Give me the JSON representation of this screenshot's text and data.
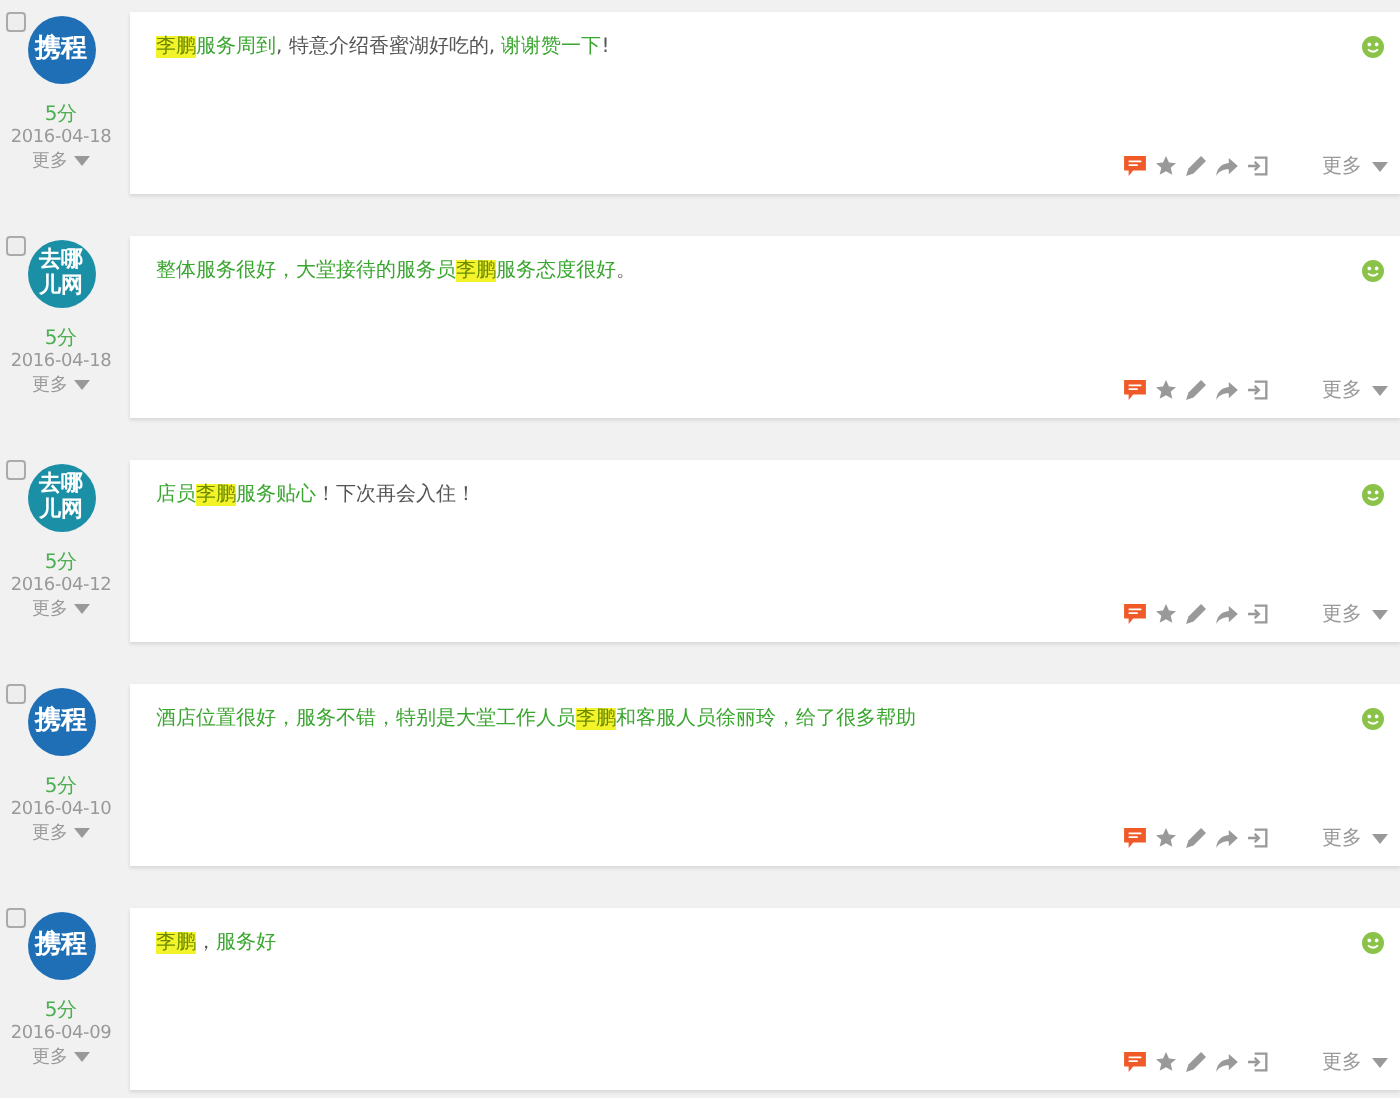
{
  "reviews": [
    {
      "checked": false,
      "source": {
        "kind": "ctrip",
        "label": "携程"
      },
      "score": "5分",
      "date": "2016-04-18",
      "more": "更多",
      "segments": [
        {
          "kind": "highlight",
          "text": "李鹏"
        },
        {
          "kind": "green",
          "text": "服务周到"
        },
        {
          "kind": "plain",
          "text": ", 特意介绍香蜜湖好吃的, "
        },
        {
          "kind": "green",
          "text": "谢谢赞一下"
        },
        {
          "kind": "plain",
          "text": "!"
        }
      ],
      "footer_more": "更多"
    },
    {
      "checked": false,
      "source": {
        "kind": "qunar",
        "label": "去哪儿网"
      },
      "score": "5分",
      "date": "2016-04-18",
      "more": "更多",
      "segments": [
        {
          "kind": "green",
          "text": "整体服务很好，大堂接待的服务员"
        },
        {
          "kind": "highlight",
          "text": "李鹏"
        },
        {
          "kind": "green",
          "text": "服务态度很好"
        },
        {
          "kind": "plain",
          "text": "。"
        }
      ],
      "footer_more": "更多"
    },
    {
      "checked": false,
      "source": {
        "kind": "qunar",
        "label": "去哪儿网"
      },
      "score": "5分",
      "date": "2016-04-12",
      "more": "更多",
      "segments": [
        {
          "kind": "green",
          "text": "店员"
        },
        {
          "kind": "highlight",
          "text": "李鹏"
        },
        {
          "kind": "green",
          "text": "服务贴心"
        },
        {
          "kind": "plain",
          "text": "！下次再会入住！"
        }
      ],
      "footer_more": "更多"
    },
    {
      "checked": false,
      "source": {
        "kind": "ctrip",
        "label": "携程"
      },
      "score": "5分",
      "date": "2016-04-10",
      "more": "更多",
      "segments": [
        {
          "kind": "green",
          "text": "酒店位置很好，服务不错，特别是大堂工作人员"
        },
        {
          "kind": "highlight",
          "text": "李鹏"
        },
        {
          "kind": "green",
          "text": "和客服人员徐丽玲，给了很多帮助"
        }
      ],
      "footer_more": "更多"
    },
    {
      "checked": false,
      "source": {
        "kind": "ctrip",
        "label": "携程"
      },
      "score": "5分",
      "date": "2016-04-09",
      "more": "更多",
      "segments": [
        {
          "kind": "highlight",
          "text": "李鹏"
        },
        {
          "kind": "plain",
          "text": "，"
        },
        {
          "kind": "green",
          "text": "服务好"
        }
      ],
      "footer_more": "更多"
    }
  ]
}
